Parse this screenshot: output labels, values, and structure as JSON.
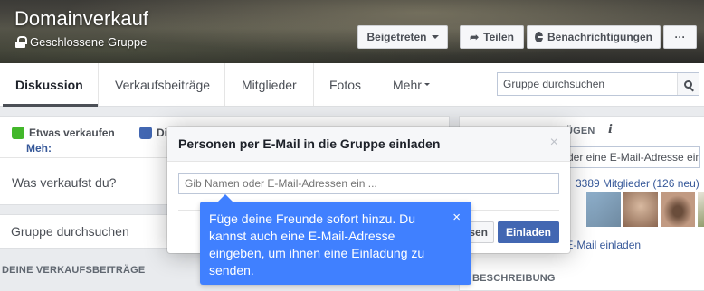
{
  "cover": {
    "title": "Domainverkauf",
    "privacy": "Geschlossene Gruppe",
    "joined_button": "Beigetreten",
    "share_button": "Teilen",
    "notifications_button": "Benachrichtigungen",
    "more_button": "···"
  },
  "nav": {
    "tabs": [
      {
        "label": "Diskussion",
        "active": true
      },
      {
        "label": "Verkaufsbeiträge"
      },
      {
        "label": "Mitglieder"
      },
      {
        "label": "Fotos"
      },
      {
        "label": "Mehr"
      }
    ],
    "search_placeholder": "Gruppe durchsuchen"
  },
  "composer": {
    "sell_label": "Etwas verkaufen",
    "discuss_label": "Di",
    "more_label": "Meh:",
    "prompt": "Was verkaufst du?"
  },
  "left": {
    "group_search": "Gruppe durchsuchen",
    "section_title": "DEINE VERKAUFSBEITRÄGE"
  },
  "right": {
    "add_header": "ÜGEN",
    "info_icon": "i",
    "add_input": "der eine E-Mail-Adresse ein",
    "members": "3389 Mitglieder (126 neu)",
    "invite_link": "r E-Mail einladen",
    "description_title": "BESCHREIBUNG",
    "thumb_colors": [
      "#7a9bb5",
      "#b48a6e",
      "#8a6a55",
      "#6b7b4a"
    ]
  },
  "modal": {
    "title": "Personen per E-Mail in die Gruppe einladen",
    "close": "×",
    "input_placeholder": "Gib Namen oder E-Mail-Adressen ein ...",
    "cancel_label": "sen",
    "invite_label": "Einladen"
  },
  "tooltip": {
    "text": "Füge deine Freunde sofort hinzu. Du kannst auch eine E-Mail-Adresse eingeben, um ihnen eine Einladung zu senden.",
    "close": "×"
  }
}
